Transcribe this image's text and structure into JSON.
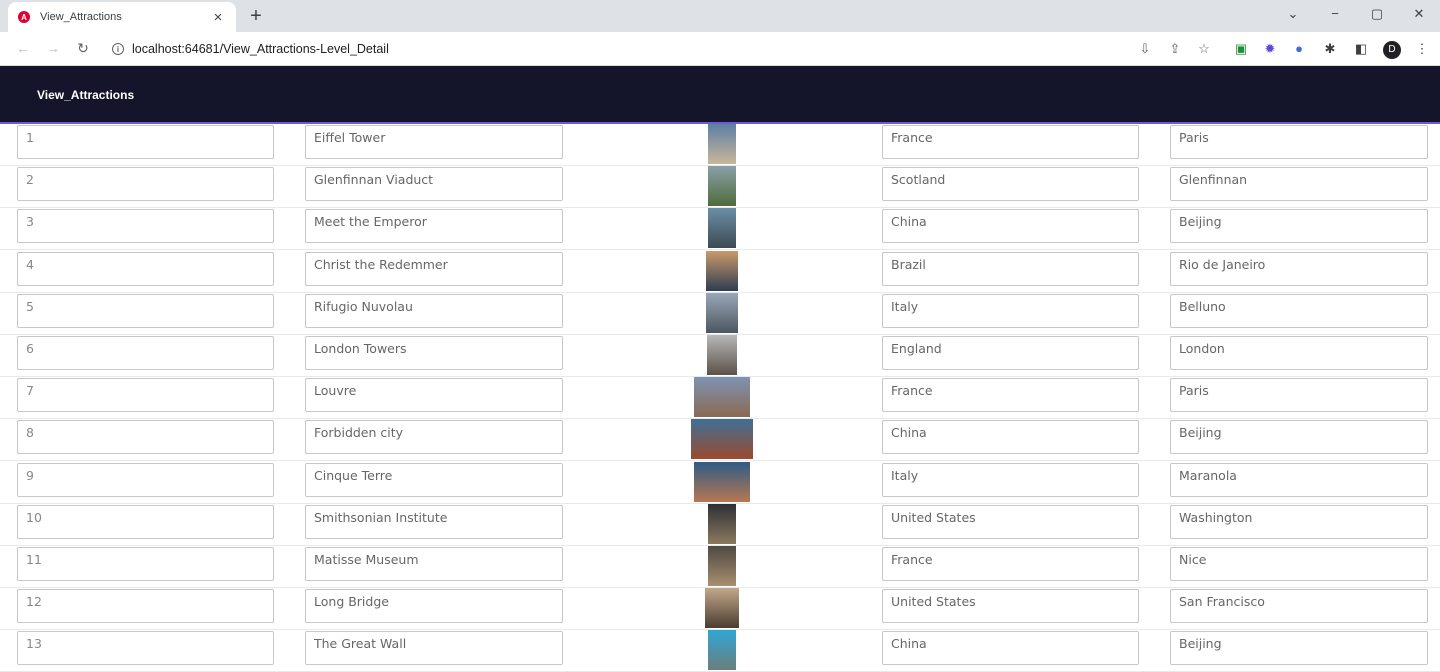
{
  "browser": {
    "tab_title": "View_Attractions",
    "tab_close": "×",
    "new_tab": "+",
    "url": "localhost:64681/View_Attractions-Level_Detail",
    "avatar_letter": "D",
    "window_controls": [
      "⌄",
      "−",
      "▢",
      "✕"
    ]
  },
  "app": {
    "title": "View_Attractions"
  },
  "attractions": [
    {
      "id": "1",
      "name": "Eiffel Tower",
      "country": "France",
      "city": "Paris",
      "colors": [
        "#5d7fa3",
        "#c9b79a"
      ]
    },
    {
      "id": "2",
      "name": "Glenfinnan Viaduct",
      "country": "Scotland",
      "city": "Glenfinnan",
      "colors": [
        "#8aa0a8",
        "#4f6b3a"
      ]
    },
    {
      "id": "3",
      "name": "Meet the Emperor",
      "country": "China",
      "city": "Beijing",
      "colors": [
        "#6a8fa8",
        "#3d4a52"
      ]
    },
    {
      "id": "4",
      "name": "Christ the Redemmer",
      "country": "Brazil",
      "city": "Rio de Janeiro",
      "colors": [
        "#c99a6a",
        "#2f3d52"
      ]
    },
    {
      "id": "5",
      "name": "Rifugio Nuvolau",
      "country": "Italy",
      "city": "Belluno",
      "colors": [
        "#9aa7b8",
        "#4c5660"
      ]
    },
    {
      "id": "6",
      "name": "London Towers",
      "country": "England",
      "city": "London",
      "colors": [
        "#b7b8b8",
        "#5b524a"
      ]
    },
    {
      "id": "7",
      "name": "Louvre",
      "country": "France",
      "city": "Paris",
      "colors": [
        "#7d93b3",
        "#8a6a52"
      ]
    },
    {
      "id": "8",
      "name": "Forbidden city",
      "country": "China",
      "city": "Beijing",
      "colors": [
        "#3f6f96",
        "#9b4a2e"
      ]
    },
    {
      "id": "9",
      "name": "Cinque Terre",
      "country": "Italy",
      "city": "Maranola",
      "colors": [
        "#2e5c86",
        "#b87752"
      ]
    },
    {
      "id": "10",
      "name": "Smithsonian Institute",
      "country": "United States",
      "city": "Washington",
      "colors": [
        "#2c3036",
        "#8c7a5e"
      ]
    },
    {
      "id": "11",
      "name": "Matisse Museum",
      "country": "France",
      "city": "Nice",
      "colors": [
        "#4e4a44",
        "#a98e6e"
      ]
    },
    {
      "id": "12",
      "name": "Long Bridge",
      "country": "United States",
      "city": "San Francisco",
      "colors": [
        "#c2a88a",
        "#4a3c30"
      ]
    },
    {
      "id": "13",
      "name": "The Great Wall",
      "country": "China",
      "city": "Beijing",
      "colors": [
        "#2fa6d6",
        "#6b7f7a"
      ]
    }
  ]
}
